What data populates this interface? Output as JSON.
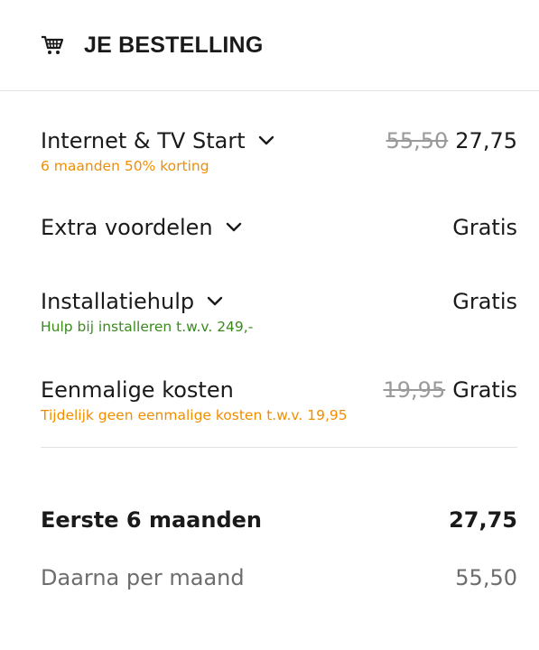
{
  "header": {
    "icon": "cart-icon",
    "title": "JE BESTELLING"
  },
  "lines": [
    {
      "name": "Internet & TV Start",
      "has_dropdown": true,
      "old_price": "55,50",
      "price": "27,75",
      "subtext": "6 maanden 50% korting",
      "subtext_color": "#f18e00"
    },
    {
      "name": "Extra voordelen",
      "has_dropdown": true,
      "price": "Gratis"
    },
    {
      "name": "Installatiehulp",
      "has_dropdown": true,
      "price": "Gratis",
      "subtext": "Hulp bij installeren t.w.v. 249,-",
      "subtext_color": "#3a8a1e"
    },
    {
      "name": "Eenmalige kosten",
      "has_dropdown": false,
      "old_price": "19,95",
      "price": "Gratis",
      "subtext": "Tijdelijk geen eenmalige kosten t.w.v. 19,95",
      "subtext_color": "#f18e00"
    }
  ],
  "totals": {
    "first_period_label": "Eerste 6 maanden",
    "first_period_value": "27,75",
    "after_label": "Daarna per maand",
    "after_value": "55,50"
  },
  "colors": {
    "accent_orange": "#f18e00",
    "accent_green": "#3a8a1e",
    "strikethrough_grey": "#9a9a9a"
  }
}
